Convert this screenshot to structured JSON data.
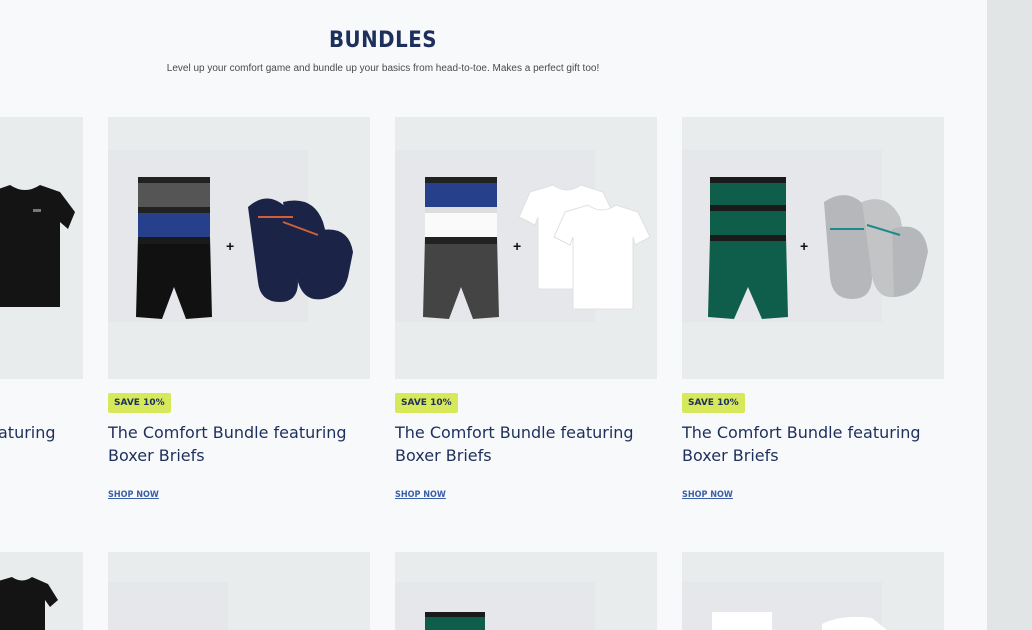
{
  "section": {
    "title": "BUNDLES",
    "subtitle": "Level up your comfort game and bundle up your basics from head-to-toe. Makes a perfect gift too!"
  },
  "cards": [
    {
      "title_partial": "aturing"
    },
    {
      "badge": "SAVE 10%",
      "title_line1": "The Comfort Bundle featuring",
      "title_line2": "Boxer Briefs",
      "cta": "SHOP NOW"
    },
    {
      "badge": "SAVE 10%",
      "title_line1": "The Comfort Bundle featuring",
      "title_line2": "Boxer Briefs",
      "cta": "SHOP NOW"
    },
    {
      "badge": "SAVE 10%",
      "title_line1": "The Comfort Bundle featuring",
      "title_line2": "Boxer Briefs",
      "cta": "SHOP NOW"
    }
  ],
  "colors": {
    "navy": "#1d2f5c",
    "badge_bg": "#d8e85b",
    "link": "#3b5ea8",
    "green_brief": "#0f5e4b",
    "blue_brief": "#27408c"
  }
}
